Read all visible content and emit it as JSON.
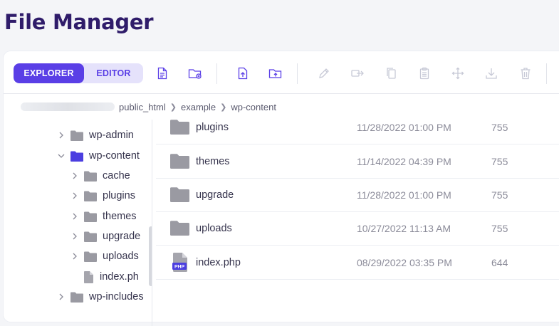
{
  "page": {
    "title": "File Manager"
  },
  "toolbar": {
    "explorer_label": "EXPLORER",
    "editor_label": "EDITOR",
    "icons": [
      "new-file-icon",
      "new-folder-icon",
      "upload-file-icon",
      "upload-folder-icon",
      "rename-icon",
      "duplicate-icon",
      "copy-icon",
      "paste-icon",
      "move-icon",
      "download-icon",
      "delete-icon"
    ]
  },
  "breadcrumb": {
    "items": [
      "public_html",
      "example",
      "wp-content"
    ]
  },
  "sidebar": {
    "items": [
      {
        "label": "wp-admin",
        "expanded": false,
        "active": false,
        "type": "folder"
      },
      {
        "label": "wp-content",
        "expanded": true,
        "active": true,
        "type": "folder"
      },
      {
        "label": "cache",
        "expanded": false,
        "active": false,
        "type": "folder"
      },
      {
        "label": "plugins",
        "expanded": false,
        "active": false,
        "type": "folder"
      },
      {
        "label": "themes",
        "expanded": false,
        "active": false,
        "type": "folder"
      },
      {
        "label": "upgrade",
        "expanded": false,
        "active": false,
        "type": "folder"
      },
      {
        "label": "uploads",
        "expanded": false,
        "active": false,
        "type": "folder"
      },
      {
        "label": "index.ph",
        "type": "file"
      },
      {
        "label": "wp-includes",
        "expanded": false,
        "active": false,
        "type": "folder"
      }
    ]
  },
  "files": [
    {
      "name": "plugins",
      "date": "11/28/2022 01:00 PM",
      "perms": "755",
      "type": "folder"
    },
    {
      "name": "themes",
      "date": "11/14/2022 04:39 PM",
      "perms": "755",
      "type": "folder"
    },
    {
      "name": "upgrade",
      "date": "11/28/2022 01:00 PM",
      "perms": "755",
      "type": "folder"
    },
    {
      "name": "uploads",
      "date": "10/27/2022 11:13 AM",
      "perms": "755",
      "type": "folder"
    },
    {
      "name": "index.php",
      "date": "08/29/2022 03:35 PM",
      "perms": "644",
      "type": "php",
      "badge": "PHP"
    }
  ],
  "colors": {
    "accent": "#5a3fe6",
    "title": "#2f1c6a",
    "folder": "#9a9aa2",
    "active_folder": "#4b3ee0"
  }
}
